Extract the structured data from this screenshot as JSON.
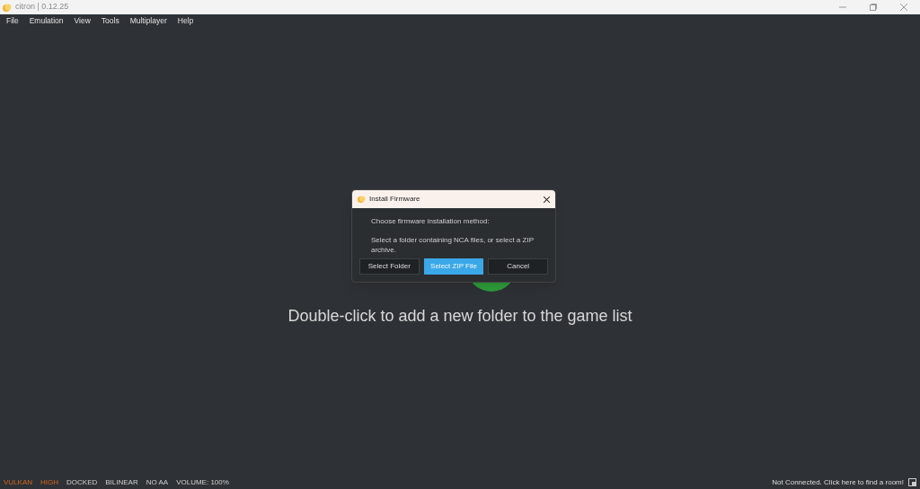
{
  "window": {
    "title": "citron | 0.12.25"
  },
  "menu": [
    "File",
    "Emulation",
    "View",
    "Tools",
    "Multiplayer",
    "Help"
  ],
  "empty_message": "Double-click to add a new folder to the game list",
  "dialog": {
    "title": "Install Firmware",
    "heading": "Choose firmware installation method:",
    "description": "Select a folder containing NCA files, or select a ZIP archive.",
    "buttons": [
      {
        "label": "Select Folder",
        "selected": false
      },
      {
        "label": "Select ZIP File",
        "selected": true
      },
      {
        "label": "Cancel",
        "selected": false
      }
    ]
  },
  "status_bar": {
    "items": [
      {
        "text": "VULKAN",
        "kind": "accent"
      },
      {
        "text": "HIGH",
        "kind": "accent"
      },
      {
        "text": "DOCKED",
        "kind": "normal"
      },
      {
        "text": "BILINEAR",
        "kind": "normal"
      },
      {
        "text": "NO AA",
        "kind": "normal"
      },
      {
        "text": "VOLUME: 100%",
        "kind": "normal"
      }
    ],
    "network": "Not Connected. Click here to find a room!"
  }
}
